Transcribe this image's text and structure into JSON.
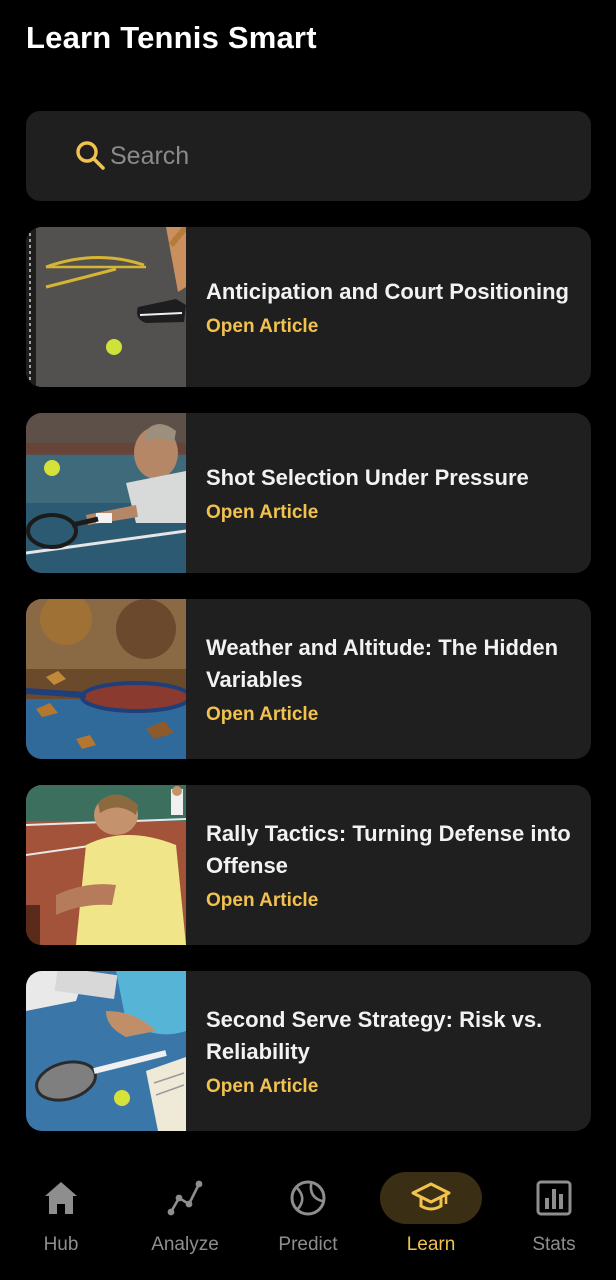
{
  "page": {
    "title": "Learn Tennis Smart"
  },
  "search": {
    "placeholder": "Search",
    "value": ""
  },
  "colors": {
    "accent": "#f2c14e",
    "card": "#1f1f1f",
    "background": "#000000",
    "muted": "#8e8e8e"
  },
  "articles": [
    {
      "title": "Anticipation and Court Positioning",
      "link_label": "Open Article",
      "image": "court-positioning-photo"
    },
    {
      "title": "Shot Selection Under Pressure",
      "link_label": "Open Article",
      "image": "player-diving-volley-photo"
    },
    {
      "title": "Weather and Altitude: The Hidden Variables",
      "link_label": "Open Article",
      "image": "racket-autumn-leaves-photo"
    },
    {
      "title": "Rally Tactics: Turning Defense into Offense",
      "link_label": "Open Article",
      "image": "player-clay-court-photo"
    },
    {
      "title": "Second Serve Strategy: Risk vs. Reliability",
      "link_label": "Open Article",
      "image": "racket-tablet-notes-photo"
    }
  ],
  "nav": {
    "items": [
      {
        "label": "Hub",
        "icon": "home-icon",
        "active": false
      },
      {
        "label": "Analyze",
        "icon": "trend-line-icon",
        "active": false
      },
      {
        "label": "Predict",
        "icon": "tennis-ball-icon",
        "active": false
      },
      {
        "label": "Learn",
        "icon": "graduation-cap-icon",
        "active": true
      },
      {
        "label": "Stats",
        "icon": "bar-chart-icon",
        "active": false
      }
    ]
  }
}
